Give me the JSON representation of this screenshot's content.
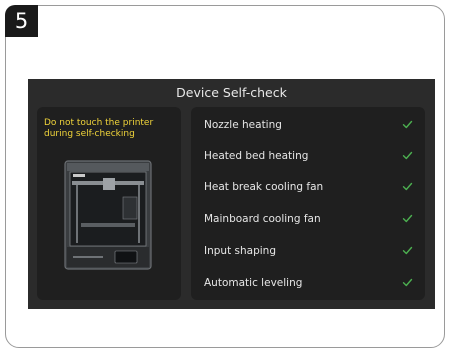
{
  "step_number": "5",
  "screen": {
    "title": "Device Self-check",
    "warning": "Do not touch the printer during self-checking",
    "printer_image": "printer-image",
    "checks": [
      {
        "label": "Nozzle heating",
        "status": "check-icon"
      },
      {
        "label": "Heated bed heating",
        "status": "check-icon"
      },
      {
        "label": "Heat break cooling fan",
        "status": "check-icon"
      },
      {
        "label": "Mainboard cooling fan",
        "status": "check-icon"
      },
      {
        "label": "Input shaping",
        "status": "check-icon"
      },
      {
        "label": "Automatic leveling",
        "status": "check-icon"
      }
    ]
  },
  "colors": {
    "screen_bg": "#2b2b2b",
    "panel_bg": "#1f1f1f",
    "warning": "#f0d43a",
    "check": "#4caf50"
  }
}
